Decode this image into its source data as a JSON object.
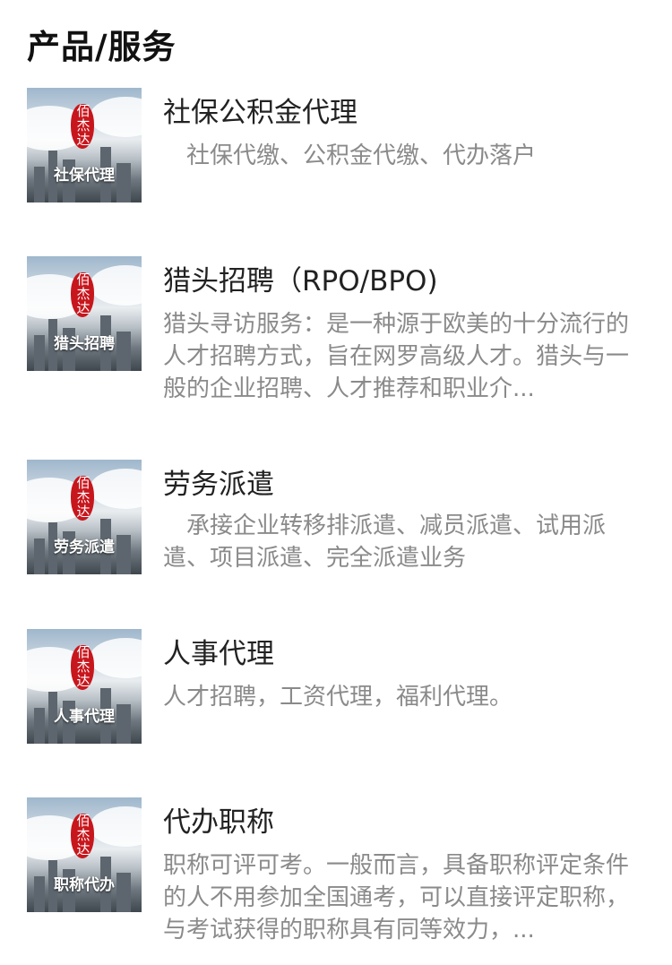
{
  "section": {
    "title": "产品/服务"
  },
  "seal_text": "佰杰达",
  "items": [
    {
      "title": "社保公积金代理",
      "desc": "　社保代缴、公积金代缴、代办落户",
      "thumb_label": "社保代理"
    },
    {
      "title": "猎头招聘（RPO/BPO)",
      "desc": "猎头寻访服务：是一种源于欧美的十分流行的人才招聘方式，旨在网罗高级人才。猎头与一般的企业招聘、人才推荐和职业介...",
      "thumb_label": "猎头招聘"
    },
    {
      "title": "劳务派遣",
      "desc": "　承接企业转移排派遣、减员派遣、试用派遣、项目派遣、完全派遣业务",
      "thumb_label": "劳务派遣"
    },
    {
      "title": "人事代理",
      "desc": " 人才招聘，工资代理，福利代理。",
      "thumb_label": "人事代理"
    },
    {
      "title": "代办职称",
      "desc": "职称可评可考。一般而言，具备职称评定条件的人不用参加全国通考，可以直接评定职称，与考试获得的职称具有同等效力，...",
      "thumb_label": "职称代办"
    }
  ]
}
